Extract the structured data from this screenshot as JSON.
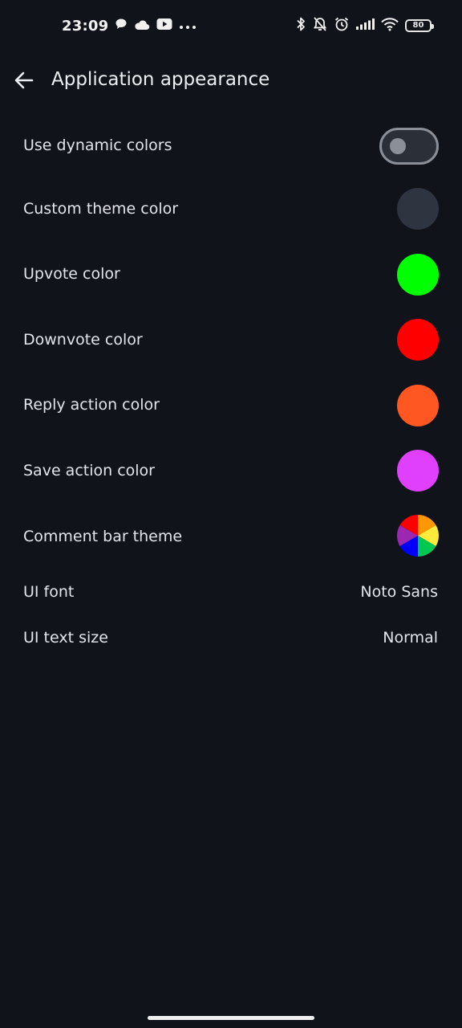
{
  "status_bar": {
    "time": "23:09",
    "left_icons": [
      "chat-bubble-icon",
      "cloud-icon",
      "youtube-icon",
      "more-dots-icon"
    ],
    "right_icons": [
      "bluetooth-icon",
      "bell-off-icon",
      "alarm-icon",
      "signal-icon",
      "wifi-icon",
      "battery-icon"
    ],
    "battery_level": "80"
  },
  "app_bar": {
    "back_icon": "arrow-back-icon",
    "title": "Application appearance"
  },
  "settings": {
    "dynamic_colors": {
      "label": "Use dynamic colors",
      "enabled": false
    },
    "custom_theme_color": {
      "label": "Custom theme color",
      "color": "#2e3440"
    },
    "upvote_color": {
      "label": "Upvote color",
      "color": "#00ff00"
    },
    "downvote_color": {
      "label": "Downvote color",
      "color": "#ff0000"
    },
    "reply_action_color": {
      "label": "Reply action color",
      "color": "#ff5722"
    },
    "save_action_color": {
      "label": "Save action color",
      "color": "#e040fb"
    },
    "comment_bar_theme": {
      "label": "Comment bar theme",
      "colors": [
        "#ff0000",
        "#ff9800",
        "#ffeb3b",
        "#00c853",
        "#0000ff",
        "#9c27b0"
      ]
    },
    "ui_font": {
      "label": "UI font",
      "value": "Noto Sans"
    },
    "ui_text_size": {
      "label": "UI text size",
      "value": "Normal"
    }
  },
  "colors": {
    "background": "#10131a",
    "text": "#e3e5ea"
  }
}
